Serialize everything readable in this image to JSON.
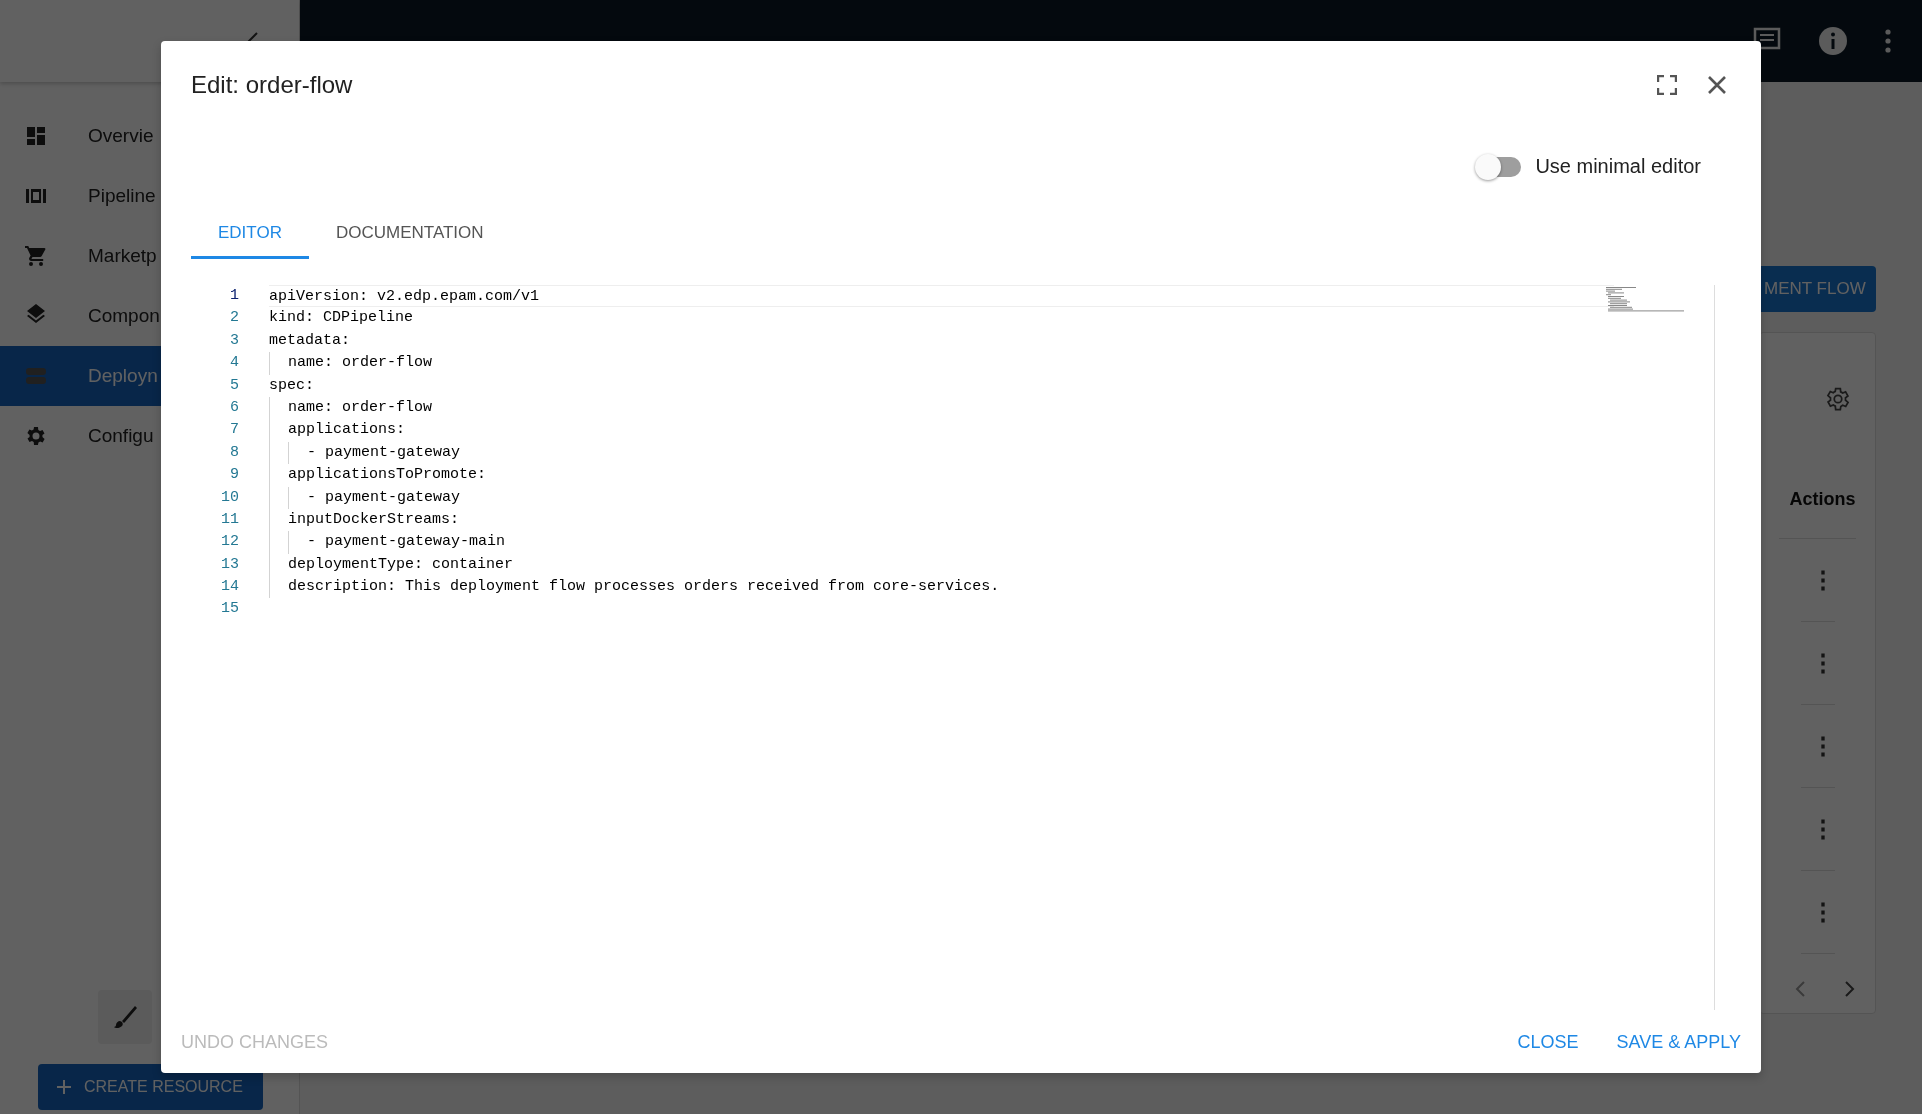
{
  "sidebar": {
    "items": [
      {
        "label": "Overvie",
        "selected": false
      },
      {
        "label": "Pipeline",
        "selected": false
      },
      {
        "label": "Marketp",
        "selected": false
      },
      {
        "label": "Compon",
        "selected": false
      },
      {
        "label": "Deployn",
        "selected": true
      },
      {
        "label": "Configu",
        "selected": false
      }
    ],
    "create_button": "CREATE RESOURCE"
  },
  "content": {
    "primary_button": "MENT FLOW",
    "table": {
      "columns": [
        "Actions"
      ],
      "rows": [
        {
          "actions": "⋮"
        },
        {
          "actions": "⋮"
        },
        {
          "actions": "⋮"
        },
        {
          "actions": "⋮"
        },
        {
          "actions": "⋮"
        }
      ]
    }
  },
  "dialog": {
    "title": "Edit: order-flow",
    "minimal_editor": {
      "label": "Use minimal editor",
      "on": false
    },
    "tabs": [
      {
        "label": "EDITOR",
        "selected": true
      },
      {
        "label": "DOCUMENTATION",
        "selected": false
      }
    ],
    "editor": {
      "lines": [
        {
          "number": "1",
          "text": "apiVersion: v2.edp.epam.com/v1",
          "current": true
        },
        {
          "number": "2",
          "text": "kind: CDPipeline",
          "current": false
        },
        {
          "number": "3",
          "text": "metadata:",
          "current": false
        },
        {
          "number": "4",
          "text": "  name: order-flow",
          "current": false
        },
        {
          "number": "5",
          "text": "spec:",
          "current": false
        },
        {
          "number": "6",
          "text": "  name: order-flow",
          "current": false
        },
        {
          "number": "7",
          "text": "  applications:",
          "current": false
        },
        {
          "number": "8",
          "text": "    - payment-gateway",
          "current": false
        },
        {
          "number": "9",
          "text": "  applicationsToPromote:",
          "current": false
        },
        {
          "number": "10",
          "text": "    - payment-gateway",
          "current": false
        },
        {
          "number": "11",
          "text": "  inputDockerStreams:",
          "current": false
        },
        {
          "number": "12",
          "text": "    - payment-gateway-main",
          "current": false
        },
        {
          "number": "13",
          "text": "  deploymentType: container",
          "current": false
        },
        {
          "number": "14",
          "text": "  description: This deployment flow processes orders received from core-services.",
          "current": false
        },
        {
          "number": "15",
          "current": false
        }
      ]
    },
    "footer": [
      {
        "label": "UNDO CHANGES",
        "disabled": true
      },
      {
        "label": "CLOSE",
        "disabled": false
      },
      {
        "label": "SAVE & APPLY",
        "disabled": false
      }
    ]
  }
}
